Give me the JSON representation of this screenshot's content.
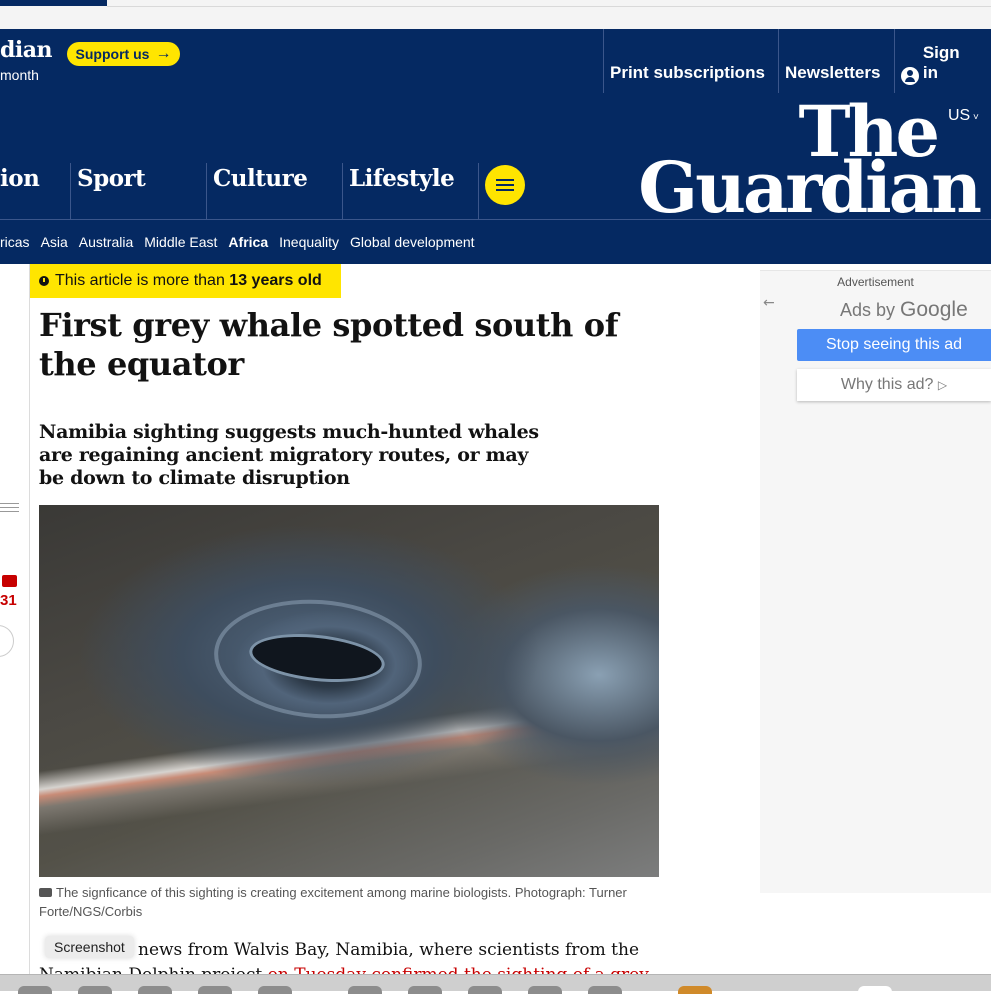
{
  "support": {
    "masthead_fragment": "dian",
    "sub_fragment": "month",
    "button_label": "Support us",
    "button_arrow": "→"
  },
  "top_links": {
    "print": "Print subscriptions",
    "newsletters": "Newsletters",
    "signin": "Sign in"
  },
  "edition": "US",
  "logo": {
    "line1": "The",
    "line2": "Guardian"
  },
  "pillars": [
    {
      "label": "ion"
    },
    {
      "label": "Sport"
    },
    {
      "label": "Culture"
    },
    {
      "label": "Lifestyle"
    }
  ],
  "subnav": [
    "ricas",
    "Asia",
    "Australia",
    "Middle East",
    "Africa",
    "Inequality",
    "Global development"
  ],
  "subnav_active": "Africa",
  "age_notice": {
    "prefix": "This article is more than",
    "age": "13 years old"
  },
  "headline": "First grey whale spotted south of the equator",
  "standfirst": "Namibia sighting suggests much-hunted whales are regaining ancient migratory routes, or may be down to climate disruption",
  "caption": "The signficance of this sighting is creating excitement among marine biologists. Photograph: Turner Forte/NGS/Corbis",
  "body": {
    "line1": "news from Walvis Bay, Namibia, where scientists from the",
    "line2_text": "Namibian Dolphin project",
    "line2_link": "on Tuesday confirmed the sighting of a grey"
  },
  "tooltip": "Screenshot",
  "comment_count": "31",
  "ad": {
    "label": "Advertisement",
    "back_icon": "←",
    "ads_by": "Ads by",
    "google": "Google",
    "stop": "Stop seeing this ad",
    "why": "Why this ad?",
    "why_icon": "▷"
  },
  "colors": {
    "brand_blue": "#052962",
    "highlight_yellow": "#ffe500",
    "link_red": "#c70000",
    "ad_blue": "#4c8df5"
  }
}
